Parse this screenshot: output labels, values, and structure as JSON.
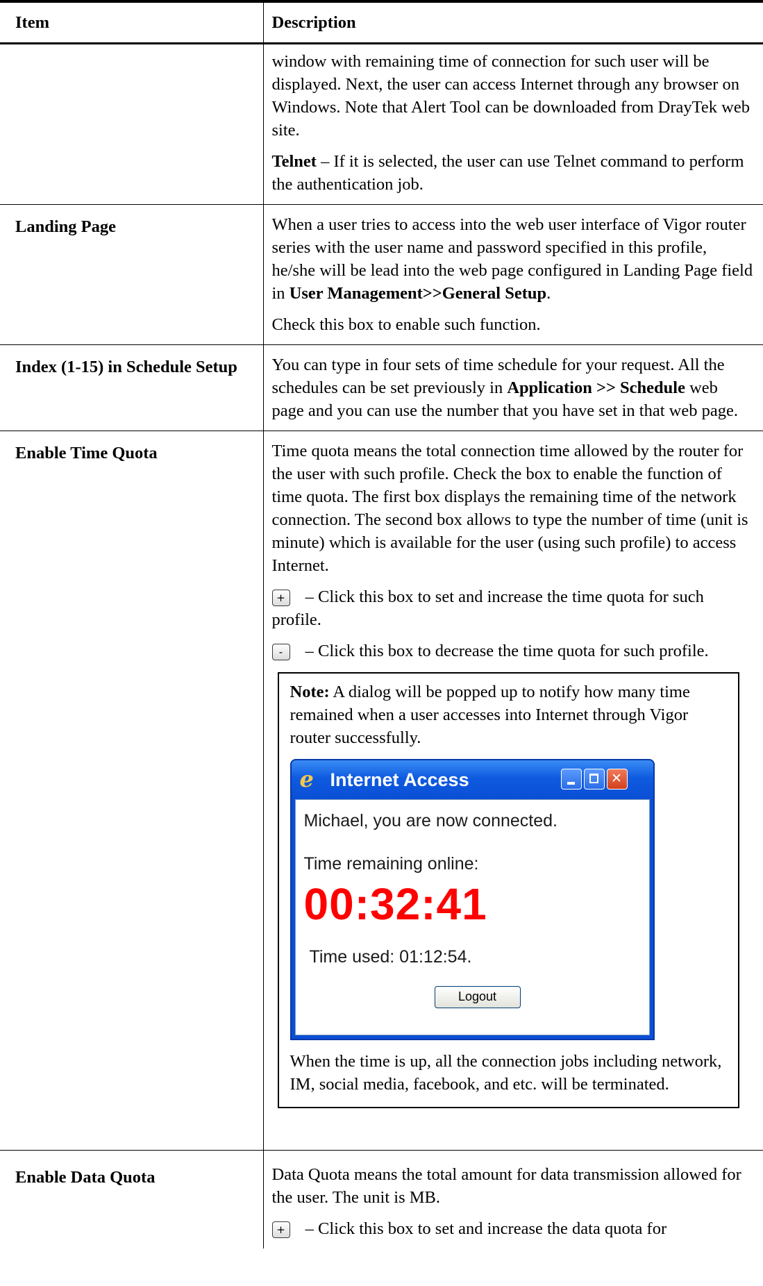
{
  "table": {
    "headers": {
      "item": "Item",
      "description": "Description"
    },
    "row_cont": {
      "p1": "window with remaining time of connection for such user will be displayed. Next, the user can access Internet through any browser on Windows. Note that Alert Tool can be downloaded from DrayTek web site.",
      "p2_bold": "Telnet",
      "p2_rest": " – If it is selected, the user can use Telnet command to perform the authentication job."
    },
    "row_landing": {
      "item": "Landing Page",
      "p1_a": "When a user tries to access into the web user interface of Vigor router series with the user name and password specified in this profile, he/she will be lead into the web page configured in Landing Page field in ",
      "p1_bold": "User Management>>General Setup",
      "p1_end": ".",
      "p2": "Check this box to enable such function."
    },
    "row_index": {
      "item": "Index (1-15) in Schedule Setup",
      "p1_a": "You can type in four sets of time schedule for your request. All the schedules can be set previously in ",
      "p1_bold": "Application >> Schedule",
      "p1_b": " web page and you can use the number that you have set in that web page."
    },
    "row_time": {
      "item": "Enable Time Quota",
      "p1": "Time quota means the total connection time allowed by the router for the user with such profile. Check the box to enable the function of time quota. The first box displays the remaining time of the network connection. The second box allows to type the number of time (unit is minute) which is available for the user (using such profile) to access Internet.",
      "plus_glyph": "+",
      "plus_text": " – Click this box to set and increase the time quota for such profile.",
      "minus_glyph": "-",
      "minus_text": " – Click this box to decrease the time quota for such profile.",
      "note_label": "Note:",
      "note_text": " A dialog will be popped up to notify how many time remained when a user accesses into Internet through Vigor router successfully.",
      "after_dialog": "When the time is up, all the connection jobs including network, IM, social media, facebook, and etc. will be terminated."
    },
    "row_data": {
      "item": "Enable Data Quota",
      "p1": "Data Quota means the total amount for data transmission allowed for the user. The unit is MB.",
      "plus_glyph": "+",
      "plus_text": " – Click this box to set and increase the data quota for"
    }
  },
  "dialog": {
    "title": "Internet Access",
    "connected": "Michael, you are now connected.",
    "remaining_label": "Time remaining online:",
    "remaining_value": "00:32:41",
    "used": "Time used: 01:12:54.",
    "logout": "Logout",
    "title_bar_color": "#0a4fd6",
    "timer_color": "#ff0000"
  }
}
